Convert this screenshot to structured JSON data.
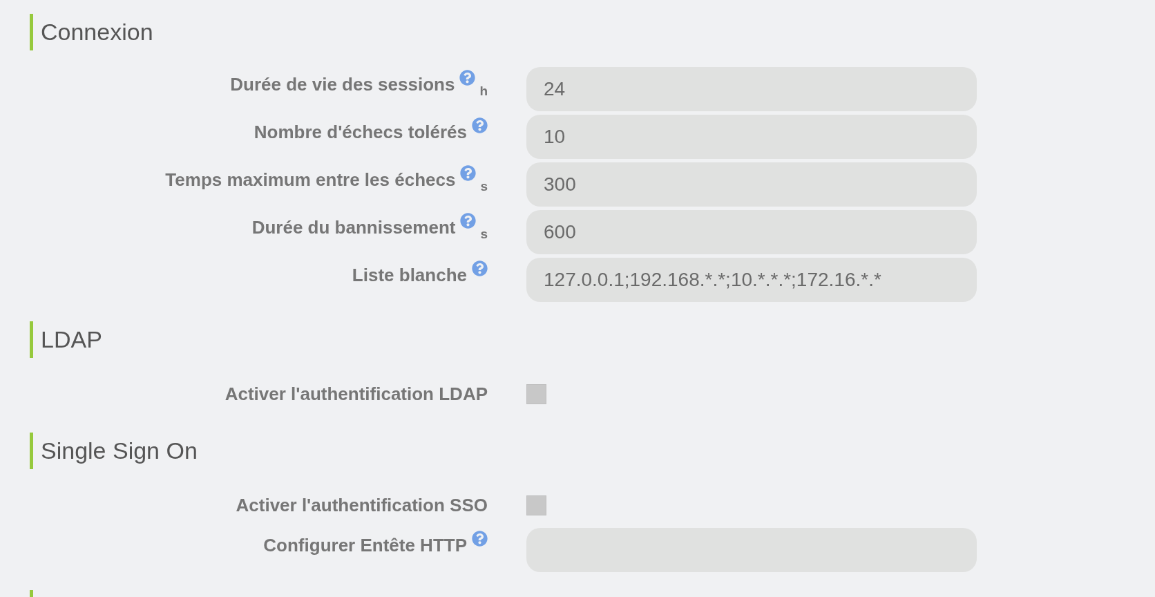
{
  "sections": [
    {
      "title": "Connexion",
      "fields": [
        {
          "kind": "text",
          "label": "Durée de vie des sessions",
          "help": true,
          "unit": "h",
          "value": "24"
        },
        {
          "kind": "text",
          "label": "Nombre d'échecs tolérés",
          "help": true,
          "value": "10"
        },
        {
          "kind": "text",
          "label": "Temps maximum entre les échecs",
          "help": true,
          "unit": "s",
          "value": "300"
        },
        {
          "kind": "text",
          "label": "Durée du bannissement",
          "help": true,
          "unit": "s",
          "value": "600"
        },
        {
          "kind": "text",
          "label": "Liste blanche",
          "help": true,
          "value": "127.0.0.1;192.168.*.*;10.*.*.*;172.16.*.*"
        }
      ]
    },
    {
      "title": "LDAP",
      "fields": [
        {
          "kind": "checkbox",
          "label": "Activer l'authentification LDAP",
          "help": false,
          "checked": false
        }
      ]
    },
    {
      "title": "Single Sign On",
      "fields": [
        {
          "kind": "checkbox",
          "label": "Activer l'authentification SSO",
          "help": false,
          "checked": false
        },
        {
          "kind": "text",
          "label": "Configurer Entête HTTP",
          "help": true
        }
      ]
    }
  ]
}
